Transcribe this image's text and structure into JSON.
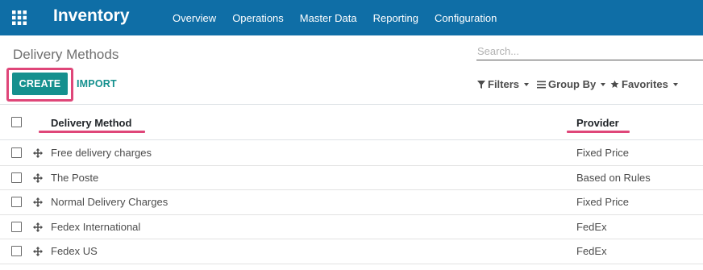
{
  "header": {
    "app_title": "Inventory",
    "menu": [
      "Overview",
      "Operations",
      "Master Data",
      "Reporting",
      "Configuration"
    ]
  },
  "control_panel": {
    "breadcrumb": "Delivery Methods",
    "search_placeholder": "Search...",
    "create_label": "CREATE",
    "import_label": "IMPORT",
    "filters_label": "Filters",
    "group_by_label": "Group By",
    "favorites_label": "Favorites"
  },
  "table": {
    "columns": [
      "Delivery Method",
      "Provider"
    ],
    "rows": [
      {
        "name": "Free delivery charges",
        "provider": "Fixed Price"
      },
      {
        "name": "The Poste",
        "provider": "Based on Rules"
      },
      {
        "name": "Normal Delivery Charges",
        "provider": "Fixed Price"
      },
      {
        "name": "Fedex International",
        "provider": "FedEx"
      },
      {
        "name": "Fedex US",
        "provider": "FedEx"
      }
    ]
  },
  "colors": {
    "navbar": "#0f6ea6",
    "primary": "#14908e",
    "highlight": "#df4679"
  }
}
